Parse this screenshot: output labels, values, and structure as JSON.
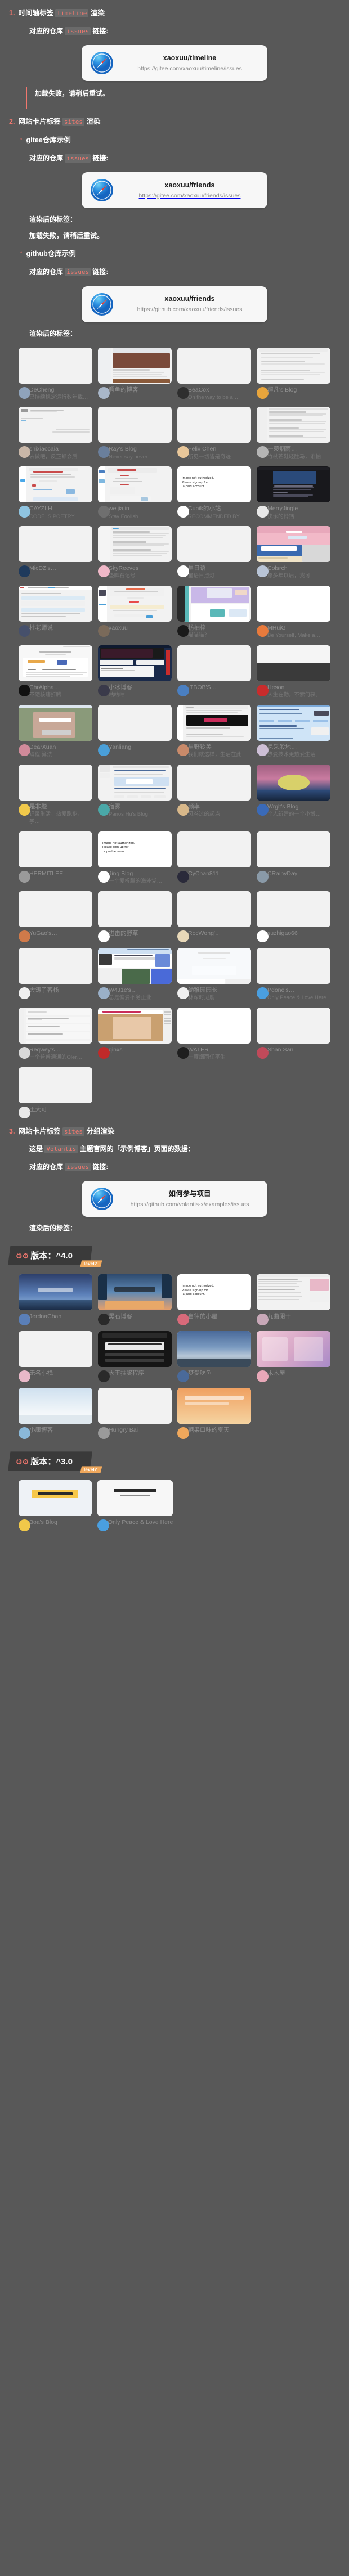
{
  "sections": [
    {
      "index": "1.",
      "title_prefix": "时间轴标签 ",
      "title_code": "timeline",
      "title_suffix": " 渲染",
      "issues_label_prefix": "对应的仓库 ",
      "issues_label_code": "issues",
      "issues_label_suffix": " 链接:",
      "link_card": {
        "title": "xaoxuu/timeline",
        "url": "https://gitee.com/xaoxuu/timeline/issues",
        "icon": "safari-compass-icon"
      },
      "notice": "加载失败，请稍后重试。"
    },
    {
      "index": "2.",
      "title_prefix": "网站卡片标签 ",
      "title_code": "sites",
      "title_suffix": " 渲染",
      "bullets": [
        {
          "label": "gitee仓库示例",
          "issues_label_prefix": "对应的仓库 ",
          "issues_label_code": "issues",
          "issues_label_suffix": " 链接:",
          "link_card": {
            "title": "xaoxuu/friends",
            "url": "https://gitee.com/xaoxuu/friends/issues",
            "icon": "safari-compass-icon"
          },
          "rendered_label": "渲染后的标签：",
          "notice": "加载失败，请稍后重试。"
        },
        {
          "label": "github仓库示例",
          "issues_label_prefix": "对应的仓库 ",
          "issues_label_code": "issues",
          "issues_label_suffix": " 链接:",
          "link_card": {
            "title": "xaoxuu/friends",
            "url": "https://github.com/xaoxuu/friends/issues",
            "icon": "safari-compass-icon"
          },
          "rendered_label": "渲染后的标签："
        }
      ]
    },
    {
      "index": "3.",
      "title_prefix": "网站卡片标签 ",
      "title_code": "sites",
      "title_suffix": " 分组渲染",
      "intro_prefix": "这是 ",
      "intro_code": "Volantis",
      "intro_suffix": " 主题官网的「示例博客」页面的数据：",
      "issues_label_prefix": "对应的仓库 ",
      "issues_label_code": "issues",
      "issues_label_suffix": " 链接:",
      "link_card": {
        "title": "如何参与项目",
        "url": "https://github.com/volantis-x/examples/issues",
        "icon": "safari-compass-icon"
      },
      "rendered_label": "渲染后的标签："
    }
  ],
  "sites_main": [
    {
      "name": "DeCheng",
      "desc": "已持续稳定运行数年载…",
      "shot": "blank",
      "avatar": "#8fa3bb"
    },
    {
      "name": "鳄鱼的博客",
      "desc": "",
      "shot": "blog1",
      "avatar": "#a9b7c9"
    },
    {
      "name": "BeaCox",
      "desc": "On the way to be a…",
      "shot": "blank",
      "avatar": "#2e2e2e"
    },
    {
      "name": "超凡's Blog",
      "desc": "",
      "shot": "list1",
      "avatar": "#e8a53c"
    },
    {
      "name": "shixiaocaia",
      "desc": "去做吧，反正都会后…",
      "shot": "doc1",
      "avatar": "#c9b7a8"
    },
    {
      "name": "Ray's Blog",
      "desc": "Never say never.",
      "shot": "blank",
      "avatar": "#6a7f9c"
    },
    {
      "name": "Felix Chen",
      "desc": "所见一切皆是奇迹",
      "shot": "blank",
      "avatar": "#e9c79a"
    },
    {
      "name": "一蓑烟雨…",
      "desc": "竹杖芒鞋轻胜马，谁怕…",
      "shot": "list2",
      "avatar": "#b5b5b5"
    },
    {
      "name": "CAYZLH",
      "desc": "CODE IS POETRY",
      "shot": "doc2",
      "avatar": "#8fc4e0"
    },
    {
      "name": "weijiajin",
      "desc": "Stay Foolish.",
      "shot": "doc3",
      "avatar": "#6f6f6f"
    },
    {
      "name": "Cubik的小站",
      "desc": "RECOMMENDED BY…",
      "shot": "notauth",
      "avatar": "#ffffff"
    },
    {
      "name": "MerryJingle",
      "desc": "快乐的铃铛",
      "shot": "dark1",
      "avatar": "#e8e8e8"
    },
    {
      "name": "MicDZ's…",
      "desc": "",
      "shot": "blank",
      "avatar": "#1f3a5c"
    },
    {
      "name": "SkyReeves",
      "desc": "垫脚石记号",
      "shot": "doc4",
      "avatar": "#f0b8c8"
    },
    {
      "name": "星日语",
      "desc": "星语日点灯",
      "shot": "blank",
      "avatar": "#ffffff"
    },
    {
      "name": "Colsrch",
      "desc": "愿多年以后，我可…",
      "shot": "pinksky",
      "avatar": "#b8c4d6"
    },
    {
      "name": "杜老师说",
      "desc": "",
      "shot": "doc5",
      "avatar": "#46506b"
    },
    {
      "name": "xaoxuu",
      "desc": "",
      "shot": "doc6",
      "avatar": "#7a6a5a"
    },
    {
      "name": "枋柚梓",
      "desc": "喵喵喵？",
      "shot": "teal1",
      "avatar": "#1a1a1a"
    },
    {
      "name": "MHuiG",
      "desc": "Be Yourself, Make a…",
      "shot": "white",
      "avatar": "#e87a3c"
    },
    {
      "name": "ChrAlpha…",
      "desc": "不硬核瞎折腾",
      "shot": "doc7",
      "avatar": "#111111"
    },
    {
      "name": "小冰博客",
      "desc": "咕咕咕",
      "shot": "chart1",
      "avatar": "#3a3a4a"
    },
    {
      "name": "ITBOB'S…",
      "desc": "",
      "shot": "blank",
      "avatar": "#4a7fc1"
    },
    {
      "name": "Heson",
      "desc": "人生在勤，不索何获。",
      "shot": "split1",
      "avatar": "#c92c2c"
    },
    {
      "name": "DearXuan",
      "desc": "编程,算法",
      "shot": "anime1",
      "avatar": "#d08a9a"
    },
    {
      "name": "Yanliang",
      "desc": "",
      "shot": "blank",
      "avatar": "#4a9fd8"
    },
    {
      "name": "星野铃美",
      "desc": "我们就这样，生活在此…",
      "shot": "doc8",
      "avatar": "#c98a6a"
    },
    {
      "name": "尼采般地…",
      "desc": "热爱技术更热爱生活",
      "shot": "blue1",
      "avatar": "#cdbfd6"
    },
    {
      "name": "是非题",
      "desc": "记录生活，热爱跑步，学…",
      "shot": "blank",
      "avatar": "#f0c84a"
    },
    {
      "name": "宿雾",
      "desc": "Panos Hu's Blog",
      "shot": "doc9",
      "avatar": "#4aa8a8"
    },
    {
      "name": "频率",
      "desc": "风卷过的起点",
      "shot": "blank",
      "avatar": "#d8b88a"
    },
    {
      "name": "Wrglt's Blog",
      "desc": "个人新建的一个小博…",
      "shot": "sunset",
      "avatar": "#3a6ab8"
    },
    {
      "name": "HERMITLEE",
      "desc": "",
      "shot": "blank",
      "avatar": "#9a9a9a"
    },
    {
      "name": "Jing Blog",
      "desc": "一个爱折腾的海外党…",
      "shot": "notauth",
      "avatar": "#ffffff"
    },
    {
      "name": "CyChan811",
      "desc": "",
      "shot": "blank",
      "avatar": "#2a2a3a"
    },
    {
      "name": "CRainyDay",
      "desc": "",
      "shot": "blank",
      "avatar": "#8a9aa8"
    },
    {
      "name": "YuGao's…",
      "desc": "",
      "shot": "blank",
      "avatar": "#d07a4a"
    },
    {
      "name": "进击的野草",
      "desc": "",
      "shot": "blank",
      "avatar": "#ffffff"
    },
    {
      "name": "RocWong'…",
      "desc": "",
      "shot": "blank",
      "avatar": "#e8d8b8"
    },
    {
      "name": "suzhigao66",
      "desc": "",
      "shot": "blank",
      "avatar": "#ffffff"
    },
    {
      "name": "大涛子客栈",
      "desc": "",
      "shot": "blank",
      "avatar": "#f0f0f0"
    },
    {
      "name": "W4J1e's…",
      "desc": "总是偏爱不务正业",
      "shot": "blue2",
      "avatar": "#9ab0c8"
    },
    {
      "name": "幼稚园园长",
      "desc": "林深时见鹿",
      "shot": "light1",
      "avatar": "#f0f0f0"
    },
    {
      "name": "Pdone's…",
      "desc": "Only Peace & Love Here",
      "shot": "blank",
      "avatar": "#4a9fe0"
    },
    {
      "name": "Reqwey's…",
      "desc": "一个普普通通的Oler…",
      "shot": "doc10",
      "avatar": "#d8d8d8"
    },
    {
      "name": "qinxs",
      "desc": "",
      "shot": "anime2",
      "avatar": "#c02a2a"
    },
    {
      "name": "WATER",
      "desc": "一蓑烟雨任平生",
      "shot": "white",
      "avatar": "#1f1f1f"
    },
    {
      "name": "Shan San",
      "desc": "",
      "shot": "blank",
      "avatar": "#c04a5a"
    },
    {
      "name": "王大可",
      "desc": "",
      "shot": "blank",
      "avatar": "#e8e8e8"
    }
  ],
  "groups": [
    {
      "version_icon": "gears-icon",
      "version_label": "版本：^4.0",
      "level_label": "level2",
      "sites": [
        {
          "name": "JerdnaChan",
          "desc": "",
          "shot": "night",
          "avatar": "#5a7fb8"
        },
        {
          "name": "黑石博客",
          "desc": "",
          "shot": "forest",
          "avatar": "#2a2a2a"
        },
        {
          "name": "自律的小屋",
          "desc": "",
          "shot": "notauth",
          "avatar": "#d86a7a"
        },
        {
          "name": "九曲阑干",
          "desc": "",
          "shot": "doc11",
          "avatar": "#c8a8b8"
        },
        {
          "name": "无名小栈",
          "desc": "",
          "shot": "grad3",
          "avatar": "#e8b8c8"
        },
        {
          "name": "大王抽奖程序",
          "desc": "",
          "shot": "dark2",
          "avatar": "#2a2a2a"
        },
        {
          "name": "梦爱吃鱼",
          "desc": "",
          "shot": "dusk",
          "avatar": "#4a6a9a"
        },
        {
          "name": "木木屋",
          "desc": "",
          "shot": "anime3",
          "avatar": "#e8a8b8"
        },
        {
          "name": "小康博客",
          "desc": "",
          "shot": "snow",
          "avatar": "#8ab8d8"
        },
        {
          "name": "Hungry Bai",
          "desc": "",
          "shot": "blank",
          "avatar": "#9a9a9a"
        },
        {
          "name": "糖果口味的夏天",
          "desc": "",
          "shot": "orange",
          "avatar": "#f0a85c"
        },
        {
          "name": "",
          "desc": "",
          "shot": "none",
          "avatar": ""
        }
      ]
    },
    {
      "version_icon": "gears-icon",
      "version_label": "版本：^3.0",
      "level_label": "level2",
      "sites": [
        {
          "name": "Boa's Blog",
          "desc": "",
          "shot": "boa",
          "avatar": "#f0c84a"
        },
        {
          "name": "Only Peace & Love Here",
          "desc": "",
          "shot": "peter",
          "avatar": "#4a9fe0"
        },
        {
          "name": "",
          "desc": "",
          "shot": "none",
          "avatar": ""
        },
        {
          "name": "",
          "desc": "",
          "shot": "none",
          "avatar": ""
        }
      ]
    }
  ]
}
